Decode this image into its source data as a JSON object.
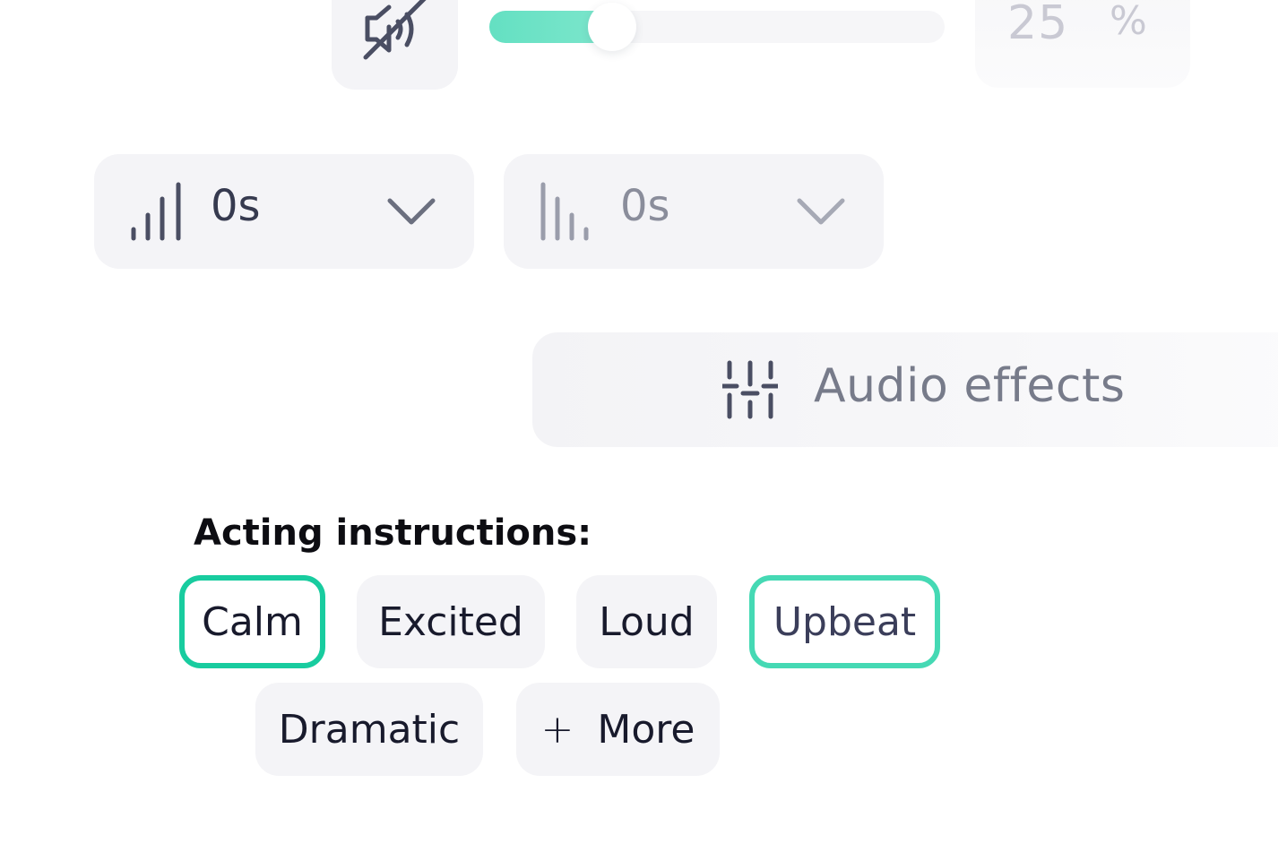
{
  "audio": {
    "mute_icon": "speaker-muted-icon",
    "volume_fraction": 0.27,
    "volume_value": "25",
    "volume_unit": "%"
  },
  "fades": [
    {
      "icon": "fade-in-bars-icon",
      "value": "0s",
      "chevron": "chevron-down-icon"
    },
    {
      "icon": "fade-out-bars-icon",
      "value": "0s",
      "chevron": "chevron-down-icon"
    }
  ],
  "effects": {
    "icon": "sliders-icon",
    "label": "Audio effects"
  },
  "acting": {
    "label": "Acting instructions:",
    "chips": [
      {
        "label": "Calm",
        "selected": true
      },
      {
        "label": "Excited",
        "selected": false
      },
      {
        "label": "Loud",
        "selected": false
      },
      {
        "label": "Upbeat",
        "selected": true
      },
      {
        "label": "Dramatic",
        "selected": false
      }
    ],
    "more_icon": "plus-icon",
    "more_label": "More"
  },
  "colors": {
    "accent": "#18cc9f",
    "chip_background": "#f4f4f7",
    "text_dark": "#181a2c"
  }
}
